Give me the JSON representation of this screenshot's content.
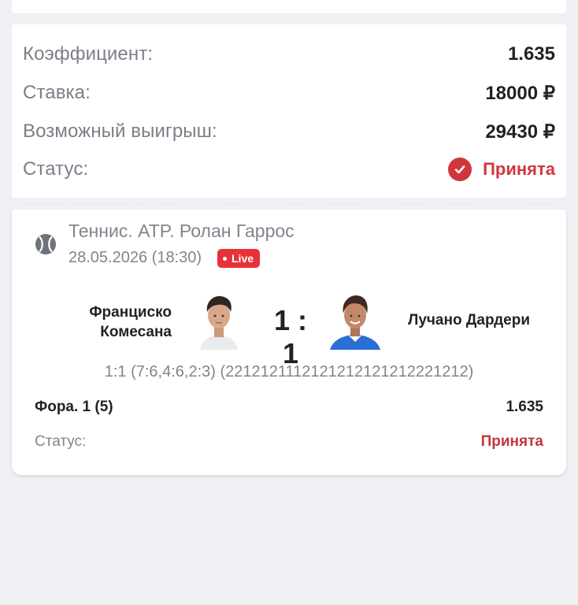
{
  "summary": {
    "coef_label": "Коэффициент:",
    "coef_value": "1.635",
    "stake_label": "Ставка:",
    "stake_value": "18000 ₽",
    "win_label": "Возможный выигрыш:",
    "win_value": "29430 ₽",
    "status_label": "Статус:",
    "status_value": "Принята",
    "status_icon": "check-circle-icon",
    "status_color": "#d1363f"
  },
  "event": {
    "sport_icon": "tennis-ball-icon",
    "league": "Теннис. ATP. Ролан Гаррос",
    "datetime": "28.05.2026 (18:30)",
    "live_badge": "Live",
    "player1_line1": "Франциско",
    "player1_line2": "Комесана",
    "player2": "Лучано Дардери",
    "score": "1 : 1",
    "score_detail": "1:1 (7:6,4:6,2:3) (2212121112121212121212221212)",
    "bet_name": "Фора. 1 (5)",
    "bet_coef": "1.635",
    "status_label": "Статус:",
    "status_value": "Принята"
  }
}
